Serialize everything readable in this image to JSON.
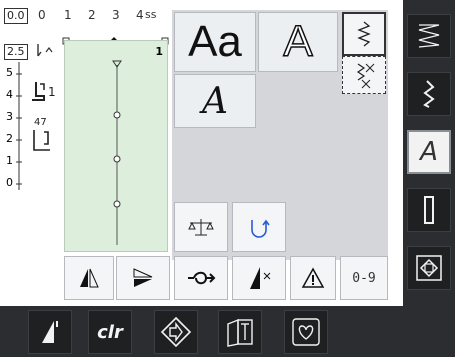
{
  "top_ruler": {
    "scale_ticks": [
      "0.0",
      "0",
      "1",
      "2",
      "3",
      "4",
      "5"
    ],
    "unit": "ss",
    "stitch_width_value": "0.0"
  },
  "left_ruler": {
    "stitch_length_value": "2.5",
    "ticks": [
      "5",
      "4",
      "3",
      "2",
      "1",
      "0"
    ]
  },
  "preview": {
    "position_number": "1",
    "foot_number_a": "1",
    "foot_number_b": "47"
  },
  "font_tiles": {
    "sans_label": "Aa",
    "outline_label": "A",
    "script_label": "A"
  },
  "buttons": {
    "counter_label": "0-9"
  },
  "bottom_bar": {
    "clr_label": "clr"
  },
  "colors": {
    "preview_bg": "#ddeedd",
    "panel_gray": "#d4d6d9",
    "sidebar_dark": "#2b2d30"
  }
}
